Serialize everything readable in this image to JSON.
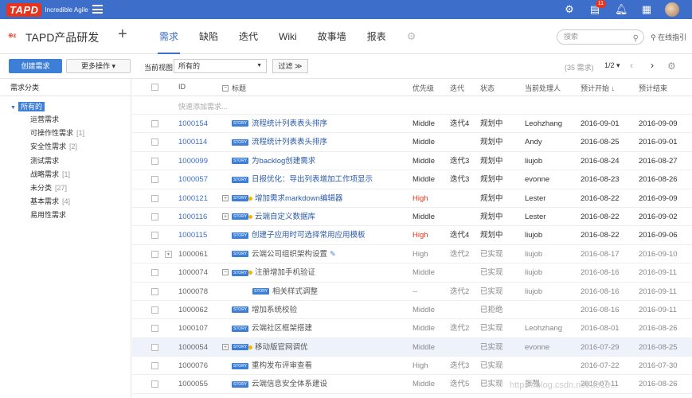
{
  "topbar": {
    "logo": "TAPD",
    "tagline": "Incredible Agile",
    "notification_count": "11"
  },
  "project": {
    "title": "TAPD产品研发",
    "tabs": [
      "需求",
      "缺陷",
      "迭代",
      "Wiki",
      "故事墙",
      "报表"
    ],
    "search_placeholder": "搜索",
    "guide": "在线指引"
  },
  "toolbar": {
    "create": "创建需求",
    "more": "更多操作 ▾",
    "view_label": "当前视图",
    "view_value": "所有的",
    "filter": "过滤 ≫",
    "count": "(35 需求)",
    "pager": "1/2 ▾"
  },
  "sidebar": {
    "heading": "需求分类",
    "root": "所有的",
    "items": [
      {
        "label": "运营需求",
        "count": ""
      },
      {
        "label": "可操作性需求",
        "count": "[1]"
      },
      {
        "label": "安全性需求",
        "count": "[2]"
      },
      {
        "label": "测试需求",
        "count": ""
      },
      {
        "label": "战略需求",
        "count": "[1]"
      },
      {
        "label": "未分类",
        "count": "[27]"
      },
      {
        "label": "基本需求",
        "count": "[4]"
      },
      {
        "label": "易用性需求",
        "count": ""
      }
    ]
  },
  "table": {
    "columns": [
      "ID",
      "标题",
      "优先级",
      "迭代",
      "状态",
      "当前处理人",
      "预计开始 ↓",
      "预计结束"
    ],
    "quick_add": "快速添加需求...",
    "story_tag": "STORY",
    "rows": [
      {
        "id": "1000154",
        "title": "流程统计列表表头排序",
        "priority": "Middle",
        "iteration": "迭代4",
        "status": "规划中",
        "owner": "Leohzhang",
        "start": "2016-09-01",
        "end": "2016-09-09"
      },
      {
        "id": "1000114",
        "title": "流程统计列表表头排序",
        "priority": "Middle",
        "iteration": "",
        "status": "规划中",
        "owner": "Andy",
        "start": "2016-08-25",
        "end": "2016-09-01"
      },
      {
        "id": "1000099",
        "title": "为backlog创建需求",
        "priority": "Middle",
        "iteration": "迭代3",
        "status": "规划中",
        "owner": "liujob",
        "start": "2016-08-24",
        "end": "2016-08-27"
      },
      {
        "id": "1000057",
        "title": "日报优化：导出列表增加工作项显示",
        "priority": "Middle",
        "iteration": "迭代3",
        "status": "规划中",
        "owner": "evonne",
        "start": "2016-08-23",
        "end": "2016-08-26"
      },
      {
        "id": "1000121",
        "title": "增加需求markdown编辑器",
        "priority": "High",
        "iteration": "",
        "status": "规划中",
        "owner": "Lester",
        "start": "2016-08-22",
        "end": "2016-09-09"
      },
      {
        "id": "1000116",
        "title": "云端自定义数据库",
        "priority": "Middle",
        "iteration": "",
        "status": "规划中",
        "owner": "Lester",
        "start": "2016-08-22",
        "end": "2016-09-02"
      },
      {
        "id": "1000115",
        "title": "创建子应用时可选择常用应用模板",
        "priority": "High",
        "iteration": "迭代4",
        "status": "规划中",
        "owner": "liujob",
        "start": "2016-08-22",
        "end": "2016-09-06"
      },
      {
        "id": "1000061",
        "title": "云端公司组织架构设置",
        "priority": "High",
        "iteration": "迭代2",
        "status": "已实现",
        "owner": "liujob",
        "start": "2016-08-17",
        "end": "2016-09-10"
      },
      {
        "id": "1000074",
        "title": "注册增加手机验证",
        "priority": "Middle",
        "iteration": "",
        "status": "已实现",
        "owner": "liujob",
        "start": "2016-08-16",
        "end": "2016-09-11"
      },
      {
        "id": "1000078",
        "title": "相关样式调整",
        "priority": "--",
        "iteration": "迭代2",
        "status": "已实现",
        "owner": "liujob",
        "start": "2016-08-16",
        "end": "2016-09-11"
      },
      {
        "id": "1000062",
        "title": "增加系统校验",
        "priority": "Middle",
        "iteration": "",
        "status": "已拒绝",
        "owner": "",
        "start": "2016-08-16",
        "end": "2016-09-11"
      },
      {
        "id": "1000107",
        "title": "云端社区框架搭建",
        "priority": "Middle",
        "iteration": "迭代2",
        "status": "已实现",
        "owner": "Leohzhang",
        "start": "2016-08-01",
        "end": "2016-08-26"
      },
      {
        "id": "1000054",
        "title": "移动版官网调优",
        "priority": "Middle",
        "iteration": "",
        "status": "已实现",
        "owner": "evonne",
        "start": "2016-07-29",
        "end": "2016-08-25"
      },
      {
        "id": "1000076",
        "title": "重构发布评审查看",
        "priority": "High",
        "iteration": "迭代3",
        "status": "已实现",
        "owner": "",
        "start": "2016-07-22",
        "end": "2016-07-30"
      },
      {
        "id": "1000055",
        "title": "云端信息安全体系建设",
        "priority": "Middle",
        "iteration": "迭代5",
        "status": "已实现",
        "owner": "张强",
        "start": "2016-07-11",
        "end": "2016-08-26"
      }
    ]
  },
  "watermark": "https://blog.csdn.net/u013..."
}
